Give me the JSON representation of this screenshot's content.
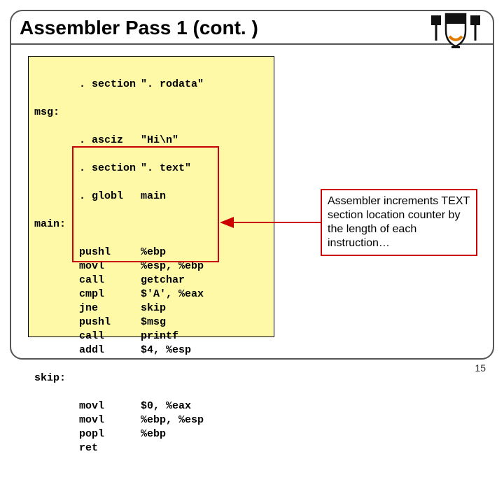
{
  "slide": {
    "title": "Assembler Pass 1 (cont. )",
    "page_number": "15"
  },
  "logo": {
    "name": "princeton-shield"
  },
  "code": {
    "labels": {
      "msg": "msg:",
      "main": "main:",
      "skip": "skip:"
    },
    "dir_rodata_mn": ". section",
    "dir_rodata_arg": "\". rodata\"",
    "dir_asciz_mn": ". asciz",
    "dir_asciz_arg": "\"Hi\\n\"",
    "dir_text_mn": ". section",
    "dir_text_arg": "\". text\"",
    "dir_globl_mn": ". globl",
    "dir_globl_arg": "main",
    "body": [
      {
        "mn": "pushl",
        "arg": "%ebp"
      },
      {
        "mn": "movl",
        "arg": "%esp, %ebp"
      },
      {
        "mn": "call",
        "arg": "getchar"
      },
      {
        "mn": "cmpl",
        "arg": "$'A', %eax"
      },
      {
        "mn": "jne",
        "arg": "skip"
      },
      {
        "mn": "pushl",
        "arg": "$msg"
      },
      {
        "mn": "call",
        "arg": "printf"
      },
      {
        "mn": "addl",
        "arg": "$4, %esp"
      }
    ],
    "tail": [
      {
        "mn": "movl",
        "arg": "$0, %eax"
      },
      {
        "mn": "movl",
        "arg": "%ebp, %esp"
      },
      {
        "mn": "popl",
        "arg": "%ebp"
      },
      {
        "mn": "ret",
        "arg": ""
      }
    ]
  },
  "annotation": {
    "text": "Assembler increments TEXT section location counter by the length of each instruction…"
  }
}
